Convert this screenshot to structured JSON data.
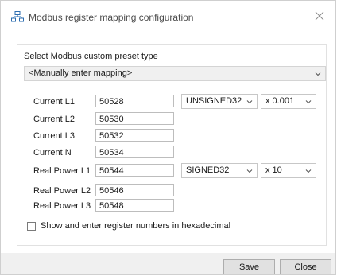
{
  "window": {
    "title": "Modbus register mapping configuration",
    "icon": "network-icon",
    "close_icon": "close-icon"
  },
  "preset": {
    "label": "Select Modbus custom preset type",
    "selected": "<Manually enter mapping>"
  },
  "rows": [
    {
      "label": "Current L1",
      "value": "50528",
      "type": "UNSIGNED32",
      "scale": "x 0.001"
    },
    {
      "label": "Current L2",
      "value": "50530"
    },
    {
      "label": "Current L3",
      "value": "50532"
    },
    {
      "label": "Current N",
      "value": "50534"
    },
    {
      "label": "Real Power L1",
      "value": "50544",
      "type": "SIGNED32",
      "scale": "x 10"
    },
    {
      "label": "Real Power L2",
      "value": "50546"
    },
    {
      "label": "Real Power L3",
      "value": "50548"
    }
  ],
  "hex_option": {
    "label": "Show and enter register numbers in hexadecimal",
    "checked": false
  },
  "buttons": {
    "save": "Save",
    "close": "Close"
  },
  "colors": {
    "footer": "#f0f0f0",
    "button": "#e1e1e1",
    "border": "#c7c7c7"
  }
}
